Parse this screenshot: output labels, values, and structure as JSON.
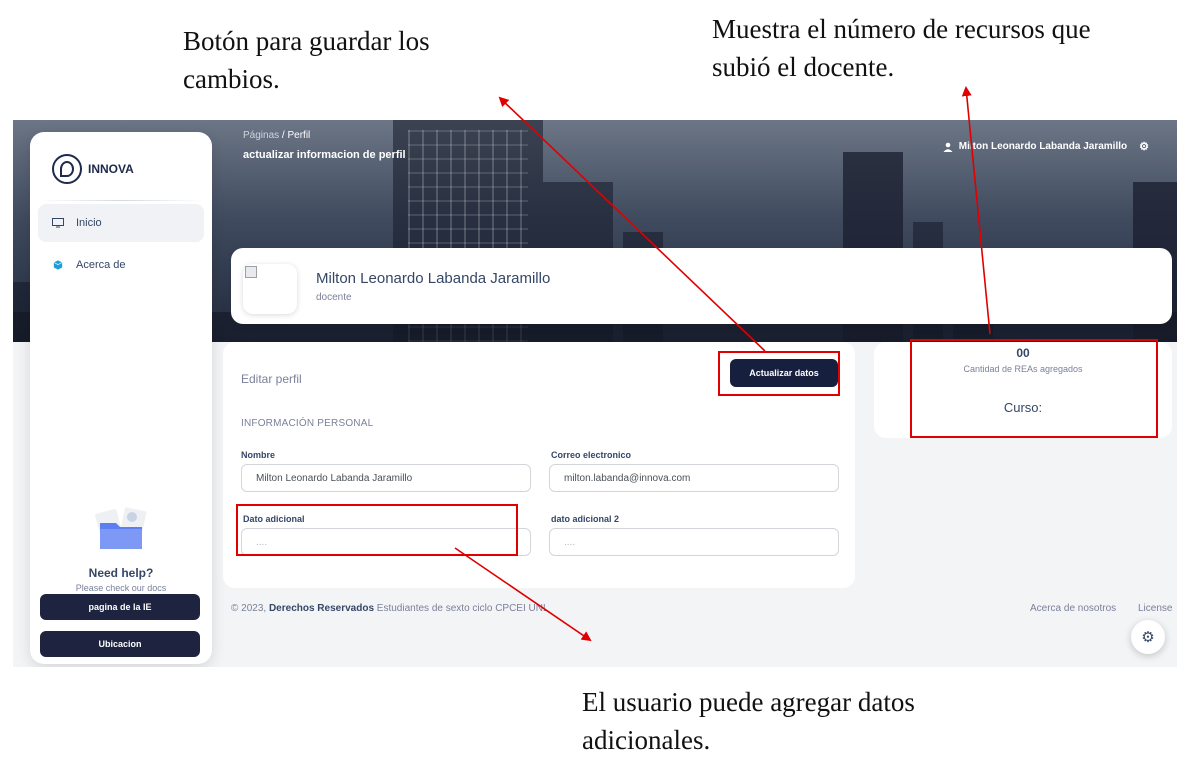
{
  "annotations": {
    "save_button": "Botón para guardar los cambios.",
    "resource_count": "Muestra el número de recursos que subió el docente.",
    "additional_data": "El usuario puede agregar datos adicionales."
  },
  "sidebar": {
    "brand": "INNOVA",
    "items": [
      {
        "label": "Inicio",
        "icon": "monitor-icon",
        "active": true
      },
      {
        "label": "Acerca de",
        "icon": "cube-icon",
        "active": false
      }
    ],
    "help": {
      "title": "Need help?",
      "subtitle": "Please check our docs"
    },
    "buttons": [
      "pagina de la IE",
      "Ubicacion"
    ]
  },
  "header": {
    "breadcrumb_parent": "Páginas",
    "breadcrumb_sep": "/",
    "breadcrumb_current": "Perfil",
    "title": "actualizar informacion de perfil",
    "user_name": "Milton Leonardo Labanda Jaramillo"
  },
  "profile": {
    "name": "Milton Leonardo Labanda Jaramillo",
    "role": "docente"
  },
  "edit": {
    "title": "Editar perfil",
    "update_button": "Actualizar datos",
    "section": "INFORMACIÓN PERSONAL",
    "fields": {
      "nombre_label": "Nombre",
      "nombre_value": "Milton Leonardo Labanda Jaramillo",
      "correo_label": "Correo electronico",
      "correo_value": "milton.labanda@innova.com",
      "dato1_label": "Dato adicional",
      "dato1_placeholder": "....",
      "dato2_label": "dato adicional 2",
      "dato2_placeholder": "...."
    }
  },
  "stats": {
    "count": "00",
    "count_label": "Cantidad de REAs agregados",
    "course": "Curso:"
  },
  "footer": {
    "copy_prefix": "© 2023,",
    "copy_bold": "Derechos Reservados",
    "copy_rest": "Estudiantes de sexto ciclo CPCEI UNL",
    "links": [
      "Acerca de nosotros",
      "License"
    ]
  },
  "colors": {
    "annotation_red": "#e00000",
    "button_dark": "#16203e"
  }
}
